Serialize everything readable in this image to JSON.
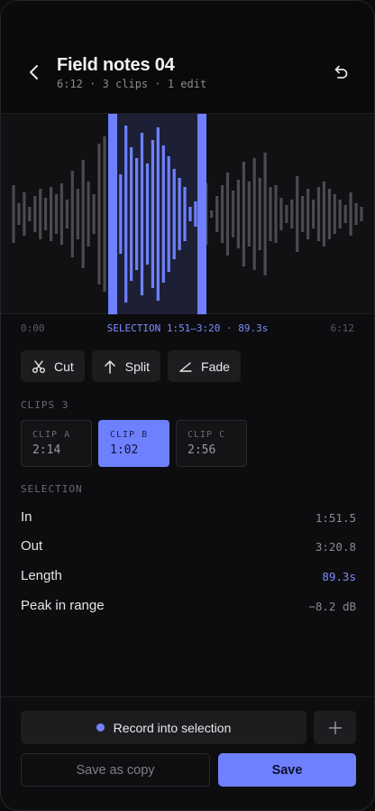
{
  "header": {
    "title": "Field notes 04",
    "subtitle": "6:12 · 3 clips · 1 edit"
  },
  "timeline": {
    "start": "0:00",
    "end": "6:12",
    "selection_label": "SELECTION 1:51–3:20 · 89.3s",
    "total_seconds": 372,
    "selection_start_seconds": 111.5,
    "selection_end_seconds": 200.8
  },
  "tools": [
    {
      "label": "Cut",
      "icon": "scissors-icon"
    },
    {
      "label": "Split",
      "icon": "arrow-up-icon"
    },
    {
      "label": "Fade",
      "icon": "fade-icon"
    }
  ],
  "clips": {
    "label": "CLIPS",
    "count": "3",
    "items": [
      {
        "name": "CLIP A",
        "duration": "2:14"
      },
      {
        "name": "CLIP B",
        "duration": "1:02"
      },
      {
        "name": "CLIP C",
        "duration": "2:56"
      }
    ],
    "active_index": 1
  },
  "selection": {
    "label": "SELECTION",
    "rows": [
      {
        "label": "In",
        "value": "1:51.5"
      },
      {
        "label": "Out",
        "value": "3:20.8"
      },
      {
        "label": "Length",
        "value": "89.3s"
      },
      {
        "label": "Peak in range",
        "value": "−8.2 dB"
      }
    ]
  },
  "actions": {
    "record": "Record into selection",
    "save_copy": "Save as copy",
    "save": "Save"
  },
  "colors": {
    "accent": "#6f80ff",
    "bar": "#4a4a4f",
    "background": "#0d0d0f"
  },
  "waveform_amplitudes": [
    0.32,
    0.12,
    0.24,
    0.08,
    0.2,
    0.28,
    0.18,
    0.3,
    0.22,
    0.34,
    0.16,
    0.48,
    0.28,
    0.6,
    0.36,
    0.22,
    0.78,
    0.86,
    0.5,
    0.7,
    0.44,
    0.98,
    0.74,
    0.62,
    0.9,
    0.56,
    0.82,
    0.96,
    0.76,
    0.64,
    0.5,
    0.4,
    0.3,
    0.08,
    0.14,
    0.1,
    0.34,
    0.04,
    0.2,
    0.32,
    0.46,
    0.26,
    0.38,
    0.58,
    0.36,
    0.62,
    0.4,
    0.68,
    0.3,
    0.32,
    0.18,
    0.1,
    0.16,
    0.42,
    0.2,
    0.28,
    0.16,
    0.3,
    0.36,
    0.28,
    0.22,
    0.16,
    0.1,
    0.24,
    0.12,
    0.08
  ]
}
